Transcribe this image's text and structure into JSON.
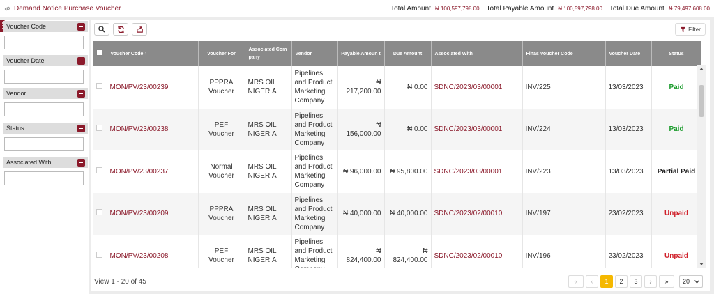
{
  "topbar": {
    "title": "Demand Notice Purchase Voucher",
    "total_amount_label": "Total Amount",
    "total_amount": "₦ 100,597,798.00",
    "total_payable_label": "Total Payable Amount",
    "total_payable": "₦ 100,597,798.00",
    "total_due_label": "Total Due Amount",
    "total_due": "₦ 79,497,608.00"
  },
  "sidebar": {
    "filters": [
      {
        "label": "Voucher Code"
      },
      {
        "label": "Voucher Date"
      },
      {
        "label": "Vendor"
      },
      {
        "label": "Status"
      },
      {
        "label": "Associated With"
      }
    ]
  },
  "toolbar": {
    "filter_label": "Filter"
  },
  "table": {
    "headers": {
      "voucher_code": "Voucher Code",
      "voucher_for": "Voucher For",
      "associated_company": "Associated Com pany",
      "vendor": "Vendor",
      "payable_amount": "Payable Amoun t",
      "due_amount": "Due Amount",
      "associated_with": "Associated With",
      "finas_voucher_code": "Finas Voucher Code",
      "voucher_date": "Voucher Date",
      "status": "Status"
    },
    "rows": [
      {
        "voucher_code": "MON/PV/23/00239",
        "voucher_for": "PPPRA Voucher",
        "company": "MRS OIL NIGERIA",
        "vendor": "Pipelines and Product Marketing Company",
        "payable": "₦ 217,200.00",
        "due": "₦ 0.00",
        "associated_with": "SDNC/2023/03/00001",
        "finas": "INV/225",
        "date": "13/03/2023",
        "status": "Paid",
        "status_kind": "paid"
      },
      {
        "voucher_code": "MON/PV/23/00238",
        "voucher_for": "PEF Voucher",
        "company": "MRS OIL NIGERIA",
        "vendor": "Pipelines and Product Marketing Company",
        "payable": "₦ 156,000.00",
        "due": "₦ 0.00",
        "associated_with": "SDNC/2023/03/00001",
        "finas": "INV/224",
        "date": "13/03/2023",
        "status": "Paid",
        "status_kind": "paid"
      },
      {
        "voucher_code": "MON/PV/23/00237",
        "voucher_for": "Normal Voucher",
        "company": "MRS OIL NIGERIA",
        "vendor": "Pipelines and Product Marketing Company",
        "payable": "₦ 96,000.00",
        "due": "₦ 95,800.00",
        "associated_with": "SDNC/2023/03/00001",
        "finas": "INV/223",
        "date": "13/03/2023",
        "status": "Partial Paid",
        "status_kind": "partial"
      },
      {
        "voucher_code": "MON/PV/23/00209",
        "voucher_for": "PPPRA Voucher",
        "company": "MRS OIL NIGERIA",
        "vendor": "Pipelines and Product Marketing Company",
        "payable": "₦ 40,000.00",
        "due": "₦ 40,000.00",
        "associated_with": "SDNC/2023/02/00010",
        "finas": "INV/197",
        "date": "23/02/2023",
        "status": "Unpaid",
        "status_kind": "unpaid"
      },
      {
        "voucher_code": "MON/PV/23/00208",
        "voucher_for": "PEF Voucher",
        "company": "MRS OIL NIGERIA",
        "vendor": "Pipelines and Product Marketing Company",
        "payable": "₦ 824,400.00",
        "due": "₦ 824,400.00",
        "associated_with": "SDNC/2023/02/00010",
        "finas": "INV/196",
        "date": "23/02/2023",
        "status": "Unpaid",
        "status_kind": "unpaid"
      }
    ]
  },
  "footer": {
    "view_info": "View 1 - 20 of 45",
    "pages": [
      "1",
      "2",
      "3"
    ],
    "current_page": "1",
    "first": "«",
    "prev": "‹",
    "next": "›",
    "last": "»",
    "page_size": "20"
  },
  "colors": {
    "accent": "#8b1a2b",
    "paid": "#1a9b2b",
    "unpaid": "#d0202a",
    "active_page": "#f5b800"
  }
}
